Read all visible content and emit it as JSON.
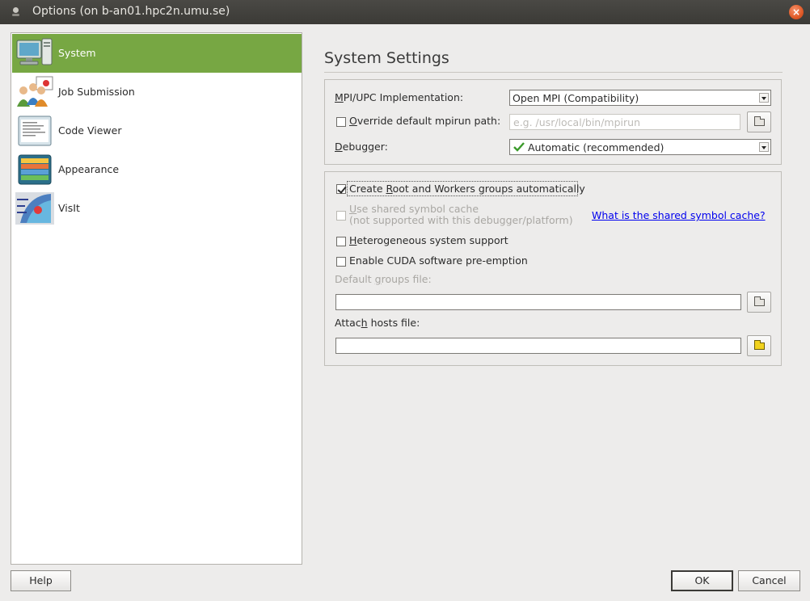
{
  "window": {
    "title": "Options (on b-an01.hpc2n.umu.se)"
  },
  "sidebar": {
    "items": [
      {
        "label": "System",
        "icon": "computer-icon",
        "selected": true
      },
      {
        "label": "Job Submission",
        "icon": "users-icon",
        "selected": false
      },
      {
        "label": "Code Viewer",
        "icon": "code-viewer-icon",
        "selected": false
      },
      {
        "label": "Appearance",
        "icon": "appearance-icon",
        "selected": false
      },
      {
        "label": "VisIt",
        "icon": "visit-icon",
        "selected": false
      }
    ]
  },
  "page": {
    "heading": "System Settings"
  },
  "mpi": {
    "implementation_label_pre": "M",
    "implementation_label_post": "PI/UPC Implementation:",
    "implementation_value": "Open MPI (Compatibility)",
    "override_label_pre": "O",
    "override_label_post": "verride default mpirun path:",
    "override_checked": false,
    "mpirun_placeholder": "e.g. /usr/local/bin/mpirun",
    "debugger_label_pre": "D",
    "debugger_label_post": "ebugger:",
    "debugger_value": "Automatic (recommended)"
  },
  "options": {
    "create_groups_pre": "Create ",
    "create_groups_u": "R",
    "create_groups_post": "oot and Workers groups automatically",
    "create_groups_checked": true,
    "shared_cache_pre": "U",
    "shared_cache_post": "se shared symbol cache",
    "shared_cache_note": "(not supported with this debugger/platform)",
    "shared_cache_link": "What is the shared symbol cache?",
    "heterogeneous_pre": "H",
    "heterogeneous_post": "eterogeneous system support",
    "cuda_label": "Enable CUDA software pre-emption",
    "default_groups_pre": "Default ",
    "default_groups_u": "g",
    "default_groups_post": "roups file:",
    "default_groups_value": "",
    "attach_hosts_pre": "Attac",
    "attach_hosts_u": "h",
    "attach_hosts_post": " hosts file:",
    "attach_hosts_value": ""
  },
  "buttons": {
    "help": "Help",
    "ok": "OK",
    "cancel": "Cancel"
  }
}
